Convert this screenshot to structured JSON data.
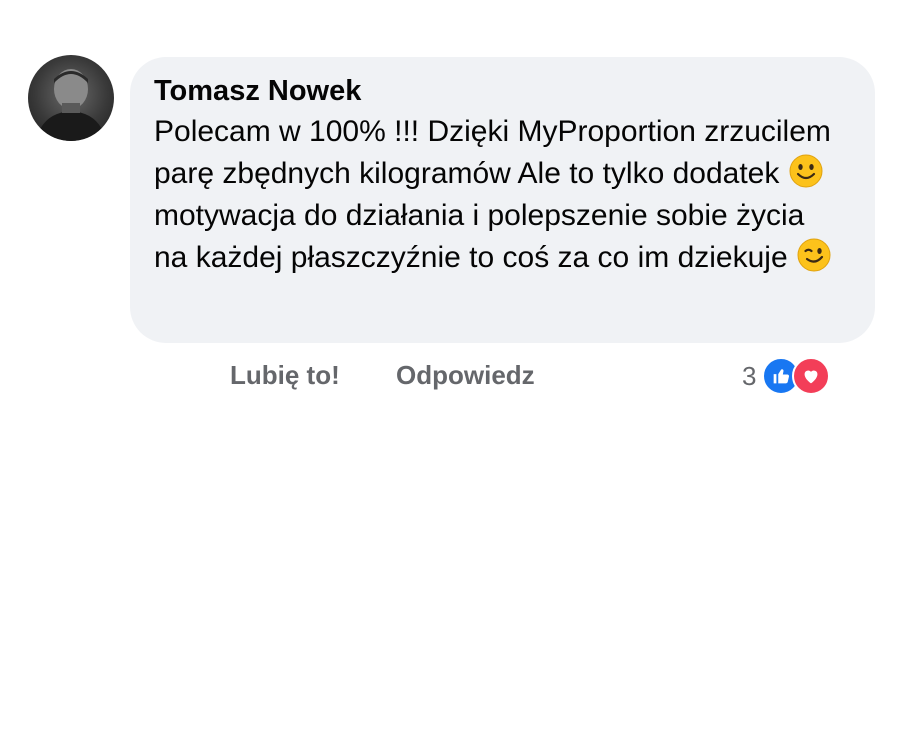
{
  "comment": {
    "author": "Tomasz Nowek",
    "text_segments": [
      "Polecam w 100% !!! Dzięki MyProportion zrzucilem parę zbędnych kilogramów Ale to tylko dodatek ",
      " motywacja do działania i polepszenie sobie życia na każdej płaszczyźnie to coś za co im dziekuje "
    ],
    "emojis": [
      "slightly-smiling-face",
      "winking-face"
    ]
  },
  "actions": {
    "like_label": "Lubię to!",
    "reply_label": "Odpowiedz"
  },
  "reactions": {
    "count": "3",
    "types": [
      "like",
      "love"
    ]
  },
  "colors": {
    "bubble": "#f0f2f5",
    "like_blue": "#1877f2",
    "love_red": "#f33e58",
    "action_gray": "#65676b"
  }
}
